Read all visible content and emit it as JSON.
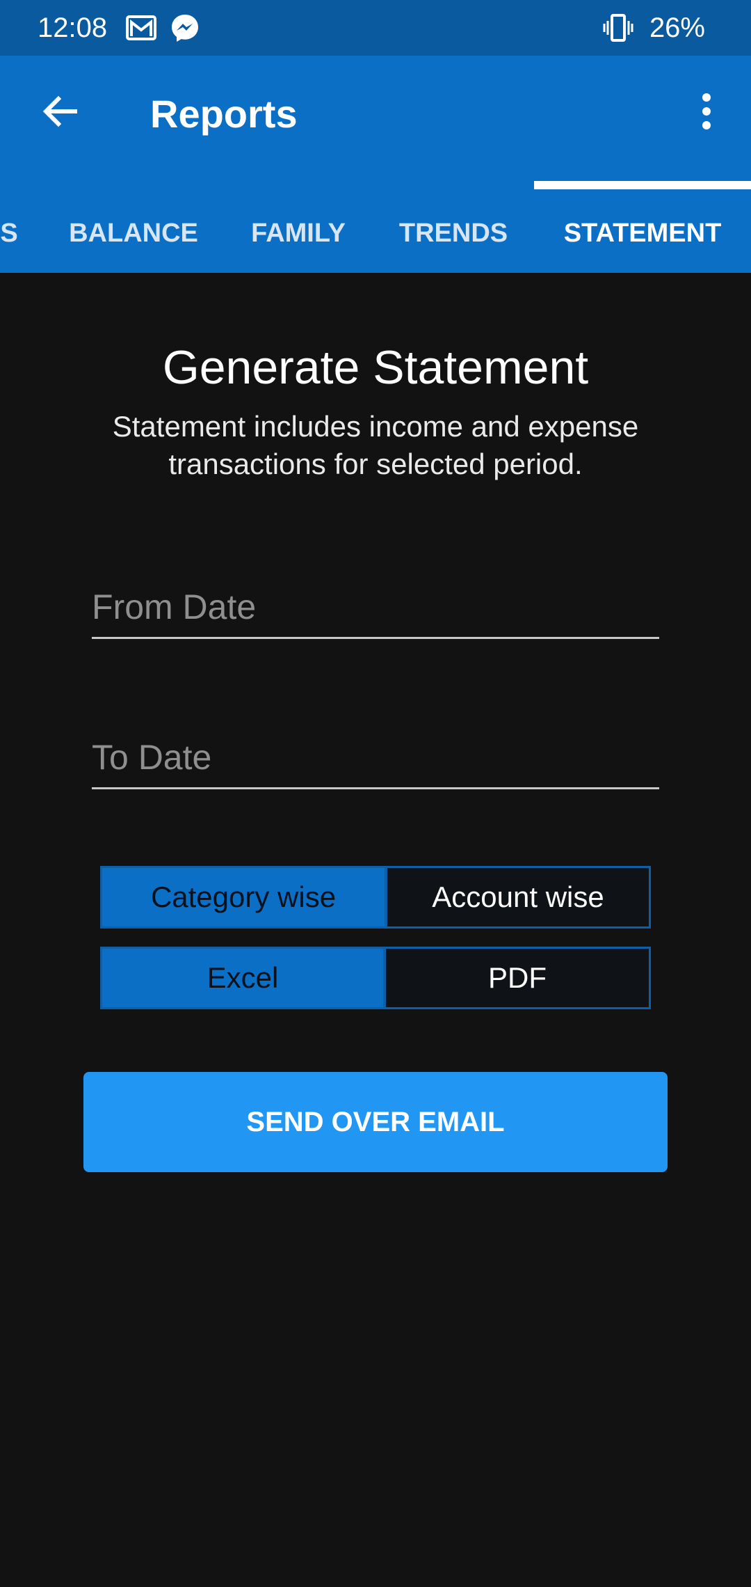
{
  "status_bar": {
    "time": "12:08",
    "icons": [
      "gmail-icon",
      "messenger-icon",
      "vibrate-icon"
    ],
    "battery": "26%"
  },
  "app_bar": {
    "title": "Reports",
    "back_icon": "arrow-back-icon",
    "menu_icon": "more-vert-icon",
    "color": "#0b6fc6"
  },
  "tabs": [
    {
      "label": "S"
    },
    {
      "label": "BALANCE"
    },
    {
      "label": "FAMILY"
    },
    {
      "label": "TRENDS"
    },
    {
      "label": "STATEMENT",
      "active": true
    }
  ],
  "main": {
    "title": "Generate Statement",
    "description": "Statement includes income and expense transactions for selected period.",
    "from_date": {
      "placeholder": "From Date",
      "value": ""
    },
    "to_date": {
      "placeholder": "To Date",
      "value": ""
    },
    "grouping": {
      "options": [
        "Category wise",
        "Account wise"
      ],
      "selected": "Category wise"
    },
    "format": {
      "options": [
        "Excel",
        "PDF"
      ],
      "selected": "Excel"
    },
    "send_button": "SEND OVER EMAIL"
  },
  "colors": {
    "background": "#121212",
    "accent": "#2196f3",
    "selected_segment": "#0b6fc6"
  }
}
